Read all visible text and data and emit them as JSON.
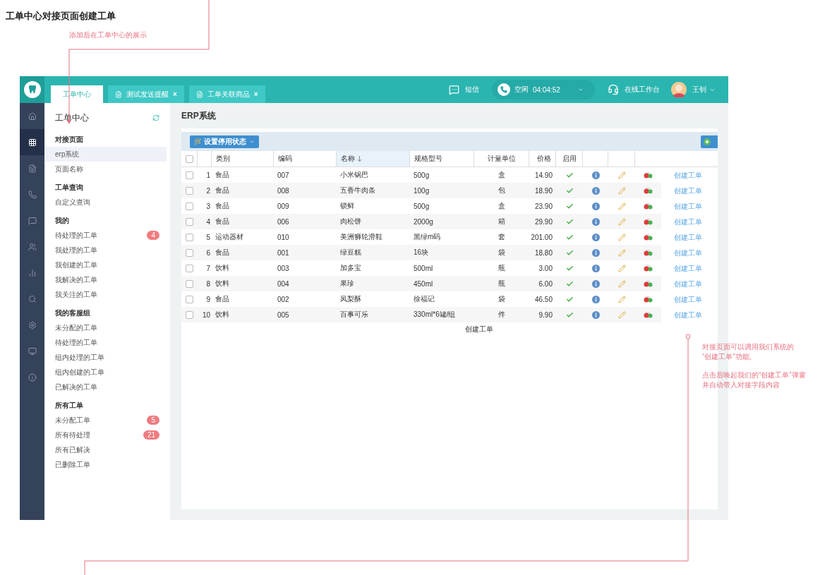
{
  "doc_title": "工单中心对接页面创建工单",
  "top_note": "添加后在工单中心的展示",
  "side_note": [
    [
      "对接页面可以调用我们系统的",
      "“创建工单”功能,"
    ],
    [
      "点击后唤起我们的“创建工单”弹窗",
      "并自动带入对接字段内容"
    ]
  ],
  "app": {
    "tabs": [
      {
        "label": "工单中心",
        "selected": true,
        "closable": false
      },
      {
        "label": "测试发送提醒",
        "selected": false,
        "closable": true
      },
      {
        "label": "工单关联商品",
        "selected": false,
        "closable": true
      }
    ],
    "close_mark": "×",
    "header": {
      "sms": "短信",
      "status": "空闲",
      "timer": "04:04:52",
      "workbench": "在线工作台",
      "user": "王钊"
    },
    "rail": [
      {
        "selected": false
      },
      {
        "selected": true
      },
      {
        "selected": false
      },
      {
        "selected": false
      },
      {
        "selected": false
      },
      {
        "selected": false
      },
      {
        "selected": false
      },
      {
        "selected": false
      },
      {
        "selected": false
      },
      {
        "selected": false
      },
      {
        "selected": false
      }
    ],
    "nav": {
      "title": "工单中心",
      "sections": [
        {
          "heading": "对接页面",
          "items": [
            {
              "label": "erp系统",
              "selected": true
            },
            {
              "label": "页面名称",
              "selected": false
            }
          ]
        },
        {
          "heading": "工单查询",
          "items": [
            {
              "label": "自定义查询",
              "selected": false
            }
          ]
        },
        {
          "heading": "我的",
          "items": [
            {
              "label": "待处理的工单",
              "selected": false,
              "badge": "4"
            },
            {
              "label": "我处理的工单",
              "selected": false
            },
            {
              "label": "我创建的工单",
              "selected": false
            },
            {
              "label": "我解决的工单",
              "selected": false
            },
            {
              "label": "我关注的工单",
              "selected": false
            }
          ]
        },
        {
          "heading": "我的客服组",
          "items": [
            {
              "label": "未分配的工单",
              "selected": false
            },
            {
              "label": "待处理的工单",
              "selected": false
            },
            {
              "label": "组内处理的工单",
              "selected": false
            },
            {
              "label": "组内创建的工单",
              "selected": false
            },
            {
              "label": "已解决的工单",
              "selected": false
            }
          ]
        },
        {
          "heading": "所有工单",
          "items": [
            {
              "label": "未分配工单",
              "selected": false,
              "badge": "5"
            },
            {
              "label": "所有待处理",
              "selected": false,
              "badge": "21"
            },
            {
              "label": "所有已解决",
              "selected": false
            },
            {
              "label": "已删除工单",
              "selected": false
            }
          ]
        }
      ]
    },
    "content": {
      "title": "ERP系统",
      "toolbar_button": "设置停用状态",
      "table": {
        "all_checked": false,
        "columns": [
          {
            "label": "类别",
            "sorted": false
          },
          {
            "label": "编码",
            "sorted": false
          },
          {
            "label": "名称",
            "sorted": true
          },
          {
            "label": "规格型号",
            "sorted": false
          },
          {
            "label": "计量单位",
            "sorted": false
          },
          {
            "label": "价格",
            "sorted": false
          },
          {
            "label": "启用",
            "sorted": false
          }
        ],
        "rows": [
          {
            "checked": false,
            "index": "1",
            "category": "食品",
            "code": "007",
            "name": "小米锅巴",
            "spec": "500g",
            "unit": "盒",
            "price": "14.90",
            "enabled": true,
            "action": "创建工单"
          },
          {
            "checked": false,
            "index": "2",
            "category": "食品",
            "code": "008",
            "name": "五香牛肉条",
            "spec": "100g",
            "unit": "包",
            "price": "18.90",
            "enabled": true,
            "action": "创建工单"
          },
          {
            "checked": false,
            "index": "3",
            "category": "食品",
            "code": "009",
            "name": "锁鲜",
            "spec": "500g",
            "unit": "盒",
            "price": "23.90",
            "enabled": true,
            "action": "创建工单"
          },
          {
            "checked": false,
            "index": "4",
            "category": "食品",
            "code": "006",
            "name": "肉松饼",
            "spec": "2000g",
            "unit": "箱",
            "price": "29.90",
            "enabled": true,
            "action": "创建工单"
          },
          {
            "checked": false,
            "index": "5",
            "category": "运动器材",
            "code": "010",
            "name": "美洲狮轮滑鞋",
            "spec": "黑绿m码",
            "unit": "套",
            "price": "201.00",
            "enabled": true,
            "action": "创建工单"
          },
          {
            "checked": false,
            "index": "6",
            "category": "食品",
            "code": "001",
            "name": "绿豆糕",
            "spec": "16块",
            "unit": "袋",
            "price": "18.80",
            "enabled": true,
            "action": "创建工单"
          },
          {
            "checked": false,
            "index": "7",
            "category": "饮料",
            "code": "003",
            "name": "加多宝",
            "spec": "500ml",
            "unit": "瓶",
            "price": "3.00",
            "enabled": true,
            "action": "创建工单"
          },
          {
            "checked": false,
            "index": "8",
            "category": "饮料",
            "code": "004",
            "name": "果珍",
            "spec": "450ml",
            "unit": "瓶",
            "price": "6.00",
            "enabled": true,
            "action": "创建工单"
          },
          {
            "checked": false,
            "index": "9",
            "category": "食品",
            "code": "002",
            "name": "凤梨酥",
            "spec": "徐福记",
            "unit": "袋",
            "price": "46.50",
            "enabled": true,
            "action": "创建工单"
          },
          {
            "checked": false,
            "index": "10",
            "category": "饮料",
            "code": "005",
            "name": "百事可乐",
            "spec": "330ml*6罐/组",
            "unit": "件",
            "price": "9.90",
            "enabled": true,
            "action": "创建工单"
          }
        ]
      },
      "stray_label": "创建工单"
    }
  }
}
